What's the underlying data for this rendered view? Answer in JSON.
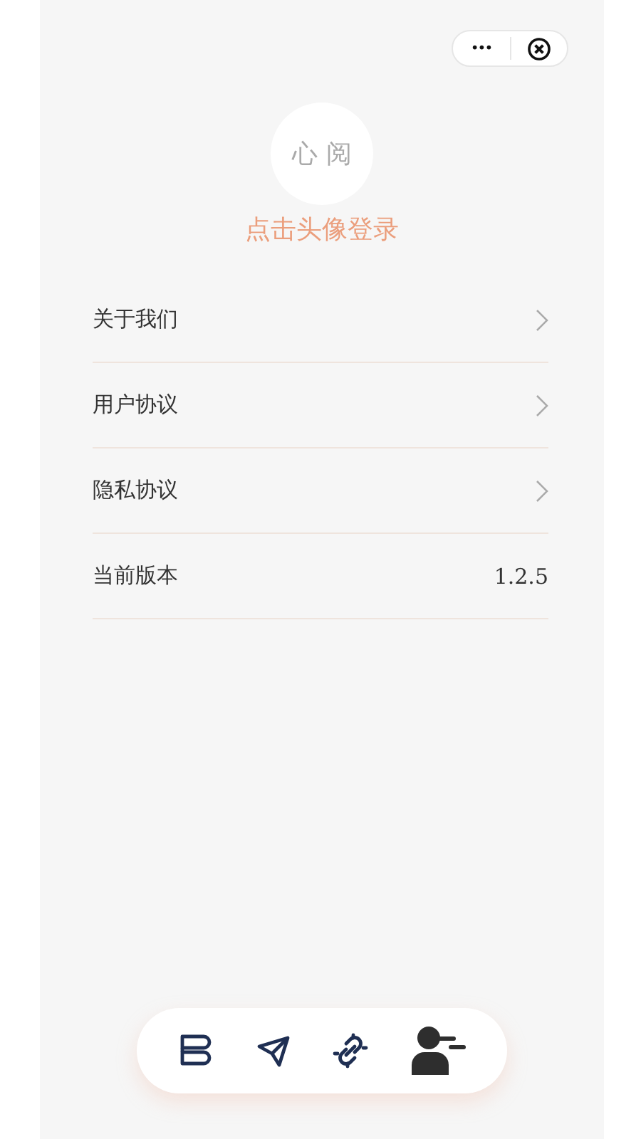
{
  "capsule": {
    "more": "•••"
  },
  "avatar": {
    "text": "心 阅"
  },
  "login_prompt": "点击头像登录",
  "menu": [
    {
      "kind": "link",
      "label": "关于我们"
    },
    {
      "kind": "link",
      "label": "用户协议"
    },
    {
      "kind": "link",
      "label": "隐私协议"
    },
    {
      "kind": "value",
      "label": "当前版本",
      "value": "1.2.5"
    }
  ],
  "tab_bar": [
    {
      "kind": "books",
      "selected": false
    },
    {
      "kind": "send",
      "selected": false
    },
    {
      "kind": "link",
      "selected": false
    },
    {
      "kind": "user",
      "selected": true
    }
  ]
}
